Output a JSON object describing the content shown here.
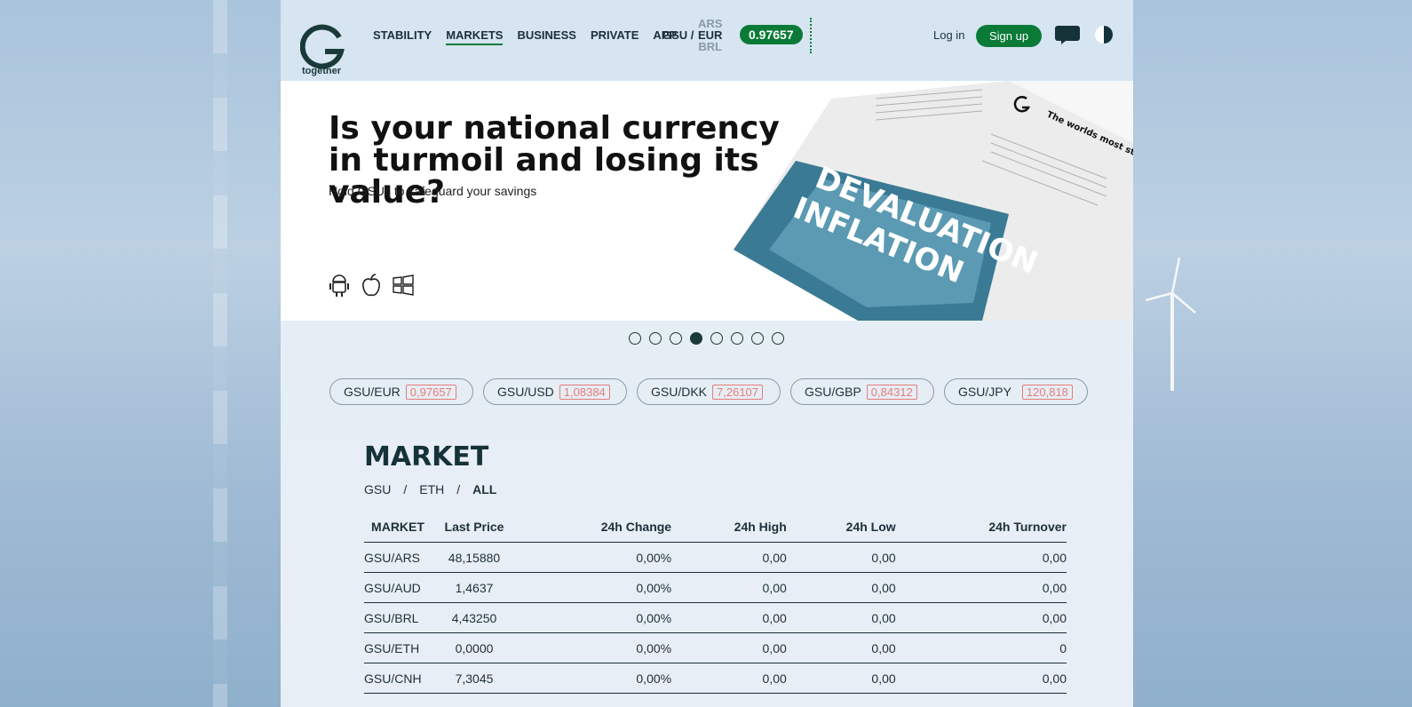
{
  "header": {
    "logo_text": "together",
    "nav": [
      "STABILITY",
      "MARKETS",
      "BUSINESS",
      "PRIVATE",
      "APP"
    ],
    "active_nav": "MARKETS",
    "gsu_label": "GSU /",
    "currencies": [
      "ARS",
      "EUR",
      "BRL"
    ],
    "selected_currency": "EUR",
    "rate": "0.97657",
    "login": "Log in",
    "signup": "Sign up",
    "accent_color": "#0a7a37"
  },
  "hero": {
    "title_line1": "Is your national currency",
    "title_line2": "in turmoil and losing its value?",
    "subtitle": "Hold GSUs to safeguard your savings",
    "store_icons": [
      "android-icon",
      "apple-icon",
      "windows-icon"
    ],
    "paper_headline1": "DEVALUATION",
    "paper_headline2": "INFLATION",
    "paper_tagline": "The worlds most stable unit"
  },
  "carousel": {
    "count": 8,
    "active_index": 3
  },
  "chips": [
    {
      "pair": "GSU/EUR",
      "value": "0,97657"
    },
    {
      "pair": "GSU/USD",
      "value": "1,08384"
    },
    {
      "pair": "GSU/DKK",
      "value": "7,26107"
    },
    {
      "pair": "GSU/GBP",
      "value": "0,84312"
    },
    {
      "pair": "GSU/JPY",
      "value": "120,818"
    }
  ],
  "market": {
    "title": "MARKET",
    "filters": [
      "GSU",
      "ETH",
      "ALL"
    ],
    "separator": "/",
    "columns": [
      "MARKET",
      "Last Price",
      "24h Change",
      "24h High",
      "24h Low",
      "24h Turnover"
    ],
    "rows": [
      [
        "GSU/ARS",
        "48,15880",
        "0,00%",
        "0,00",
        "0,00",
        "0,00"
      ],
      [
        "GSU/AUD",
        "1,4637",
        "0,00%",
        "0,00",
        "0,00",
        "0,00"
      ],
      [
        "GSU/BRL",
        "4,43250",
        "0,00%",
        "0,00",
        "0,00",
        "0,00"
      ],
      [
        "GSU/ETH",
        "0,0000",
        "0,00%",
        "0,00",
        "0,00",
        "0"
      ],
      [
        "GSU/CNH",
        "7,3045",
        "0,00%",
        "0,00",
        "0,00",
        "0,00"
      ]
    ]
  }
}
